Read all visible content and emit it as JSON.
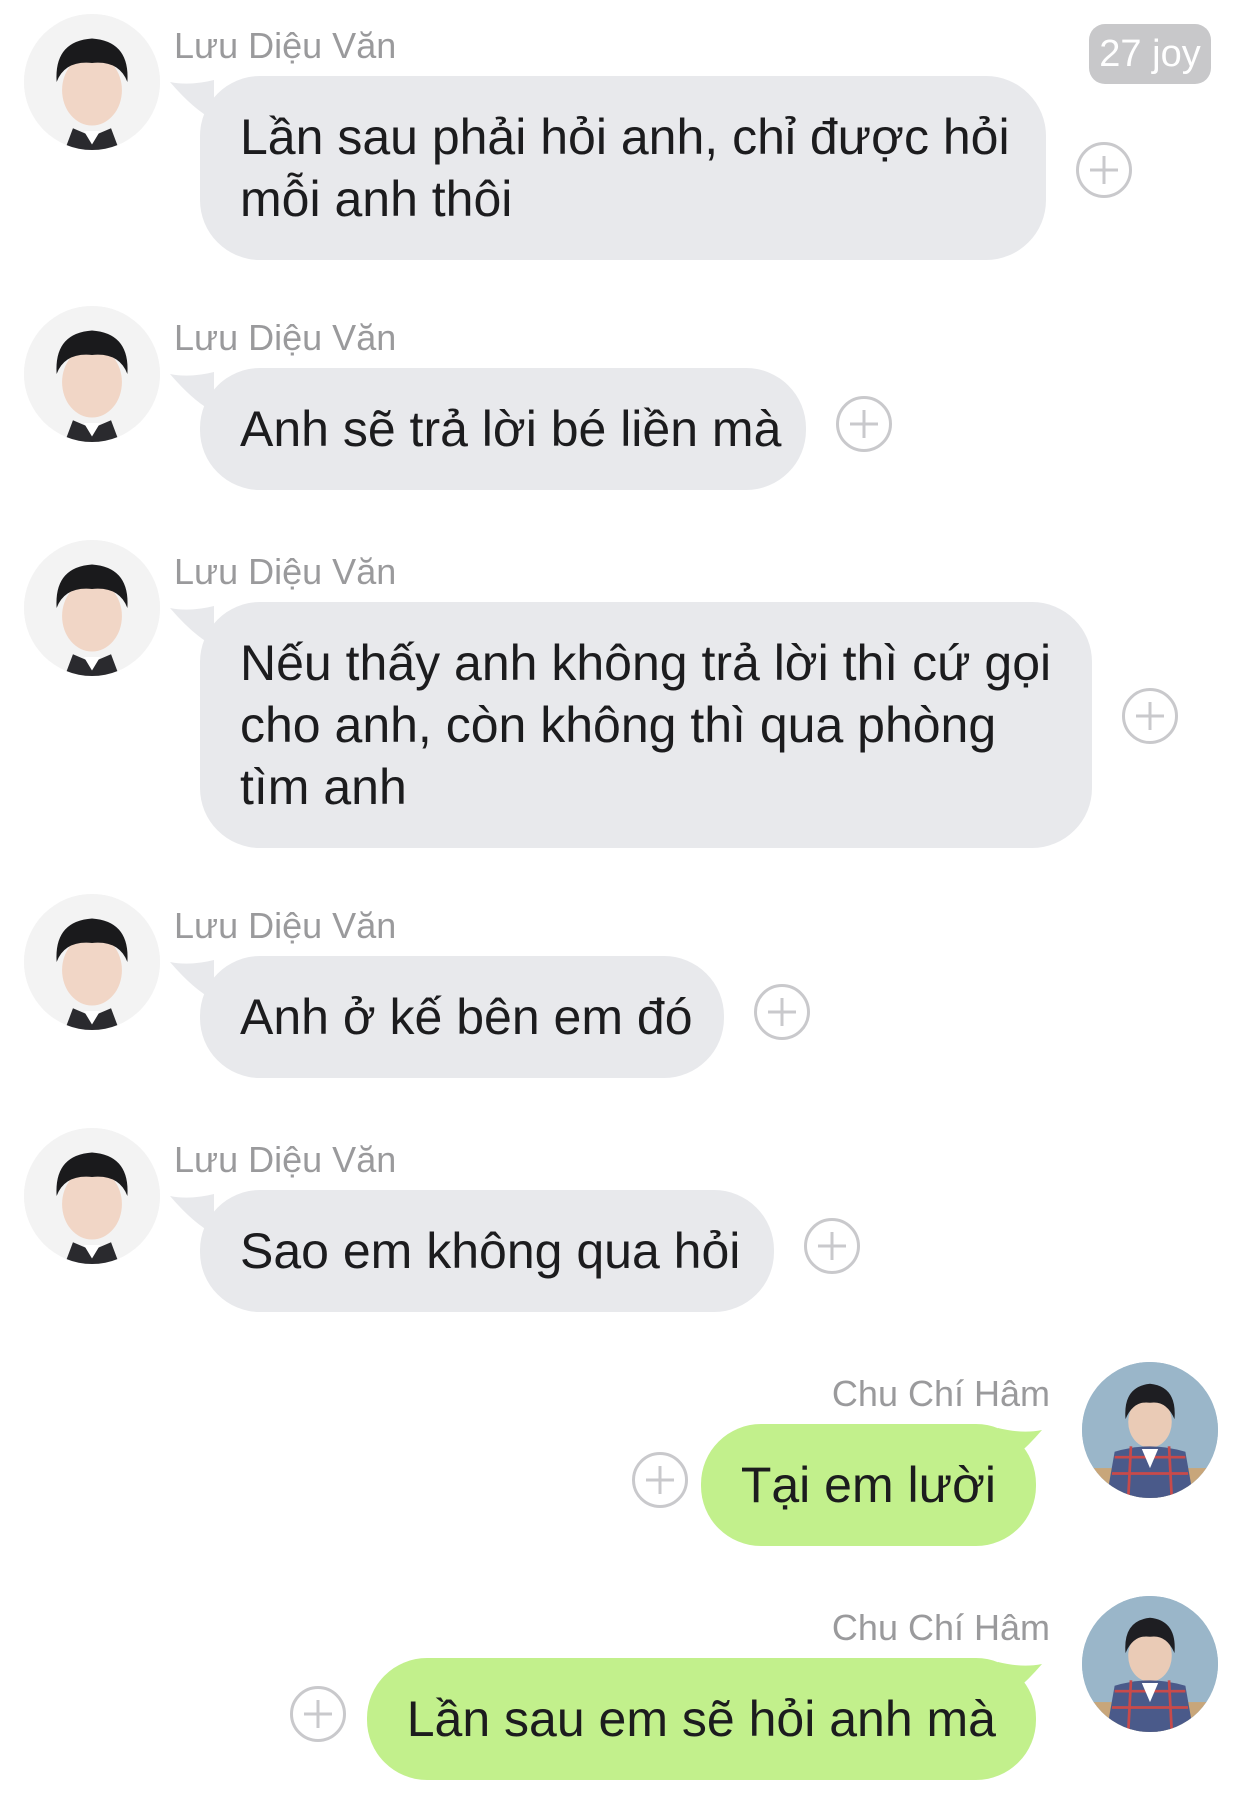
{
  "header": {
    "badge_text": "27 joy"
  },
  "messages": [
    {
      "sender": "Lưu Diệu Văn",
      "lines": [
        "Lần sau phải hỏi anh, chỉ được hỏi",
        "mỗi anh thôi"
      ]
    },
    {
      "sender": "Lưu Diệu Văn",
      "lines": [
        "Anh sẽ trả lời bé liền mà"
      ]
    },
    {
      "sender": "Lưu Diệu Văn",
      "lines": [
        "Nếu thấy anh không trả lời thì cứ gọi",
        "cho anh, còn không thì qua phòng",
        "tìm anh"
      ]
    },
    {
      "sender": "Lưu Diệu Văn",
      "lines": [
        "Anh ở kế bên em đó"
      ]
    },
    {
      "sender": "Lưu Diệu Văn",
      "lines": [
        "Sao em không qua hỏi"
      ]
    },
    {
      "sender": "Chu Chí Hâm",
      "lines": [
        "Tại em lười"
      ]
    },
    {
      "sender": "Chu Chí Hâm",
      "lines": [
        "Lần sau em sẽ hỏi anh mà"
      ]
    }
  ],
  "colors": {
    "incoming_bubble": "#e8e9ec",
    "outgoing_bubble": "#c2f08c",
    "name_text": "#9a9a9c"
  },
  "icons": {
    "react": "add-reaction-icon"
  }
}
